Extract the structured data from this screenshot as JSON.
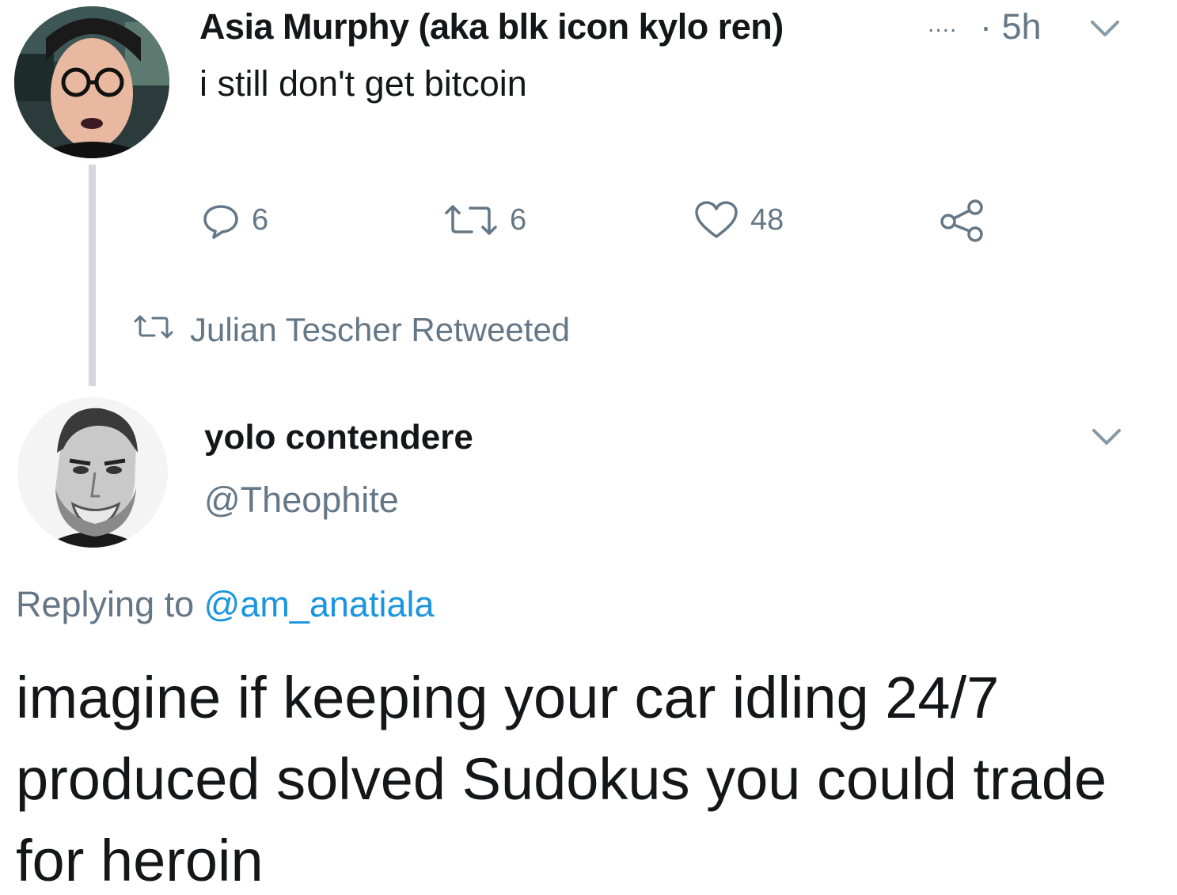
{
  "tweet1": {
    "author_name": "Asia Murphy (aka blk icon kylo ren)",
    "name_truncation": "....",
    "time": "· 5h",
    "text": "i still don't get bitcoin",
    "actions": {
      "replies": "6",
      "retweets": "6",
      "likes": "48"
    },
    "icons": [
      "reply-icon",
      "retweet-icon",
      "like-icon",
      "share-icon",
      "chevron-down-icon"
    ]
  },
  "retweet_context": {
    "text": "Julian Tescher Retweeted"
  },
  "tweet2": {
    "author_name": "yolo contendere",
    "handle": "@Theophite",
    "replying_prefix": "Replying to",
    "replying_handle": "@am_anatiala",
    "text": "imagine if keeping your car idling 24/7 produced solved Sudokus you could trade for heroin"
  },
  "colors": {
    "text": "#14171a",
    "secondary": "#657786",
    "link": "#1b95e0",
    "thread_line": "#d4d8dc"
  }
}
